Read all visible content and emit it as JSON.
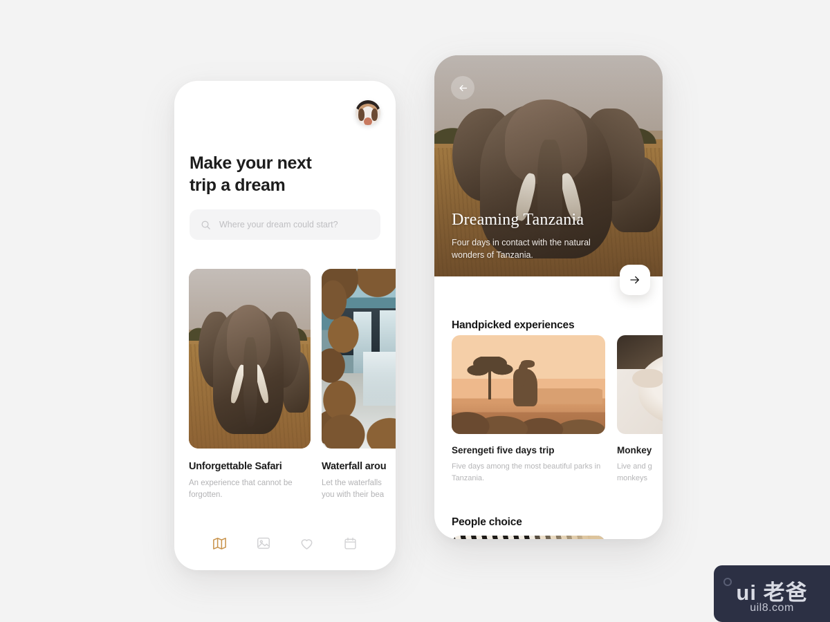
{
  "background_color": "#f3f3f3",
  "accent_color": "#c8924a",
  "left_phone": {
    "avatar": {
      "name": "user-avatar"
    },
    "headline": "Make your next\ntrip a dream",
    "search": {
      "placeholder": "Where your dream could start?",
      "value": "",
      "icon": "search-icon"
    },
    "cards": [
      {
        "image": "elephant-savanna",
        "title": "Unforgettable Safari",
        "description": "An experience that cannot be forgotten."
      },
      {
        "image": "waterfall-forest",
        "title": "Waterfall arou",
        "description": "Let the waterfalls\nyou with their bea"
      }
    ],
    "bottom_nav": [
      {
        "icon": "map-icon",
        "label": "Map",
        "active": true
      },
      {
        "icon": "image-icon",
        "label": "Gallery",
        "active": false
      },
      {
        "icon": "heart-icon",
        "label": "Favorites",
        "active": false
      },
      {
        "icon": "calendar-icon",
        "label": "Calendar",
        "active": false
      }
    ]
  },
  "right_phone": {
    "back_button": {
      "icon": "arrow-left-icon"
    },
    "hero": {
      "image": "elephants-savanna",
      "title": "Dreaming Tanzania",
      "subtitle": "Four days in contact with the natural wonders of Tanzania."
    },
    "next_button": {
      "icon": "arrow-right-icon"
    },
    "sections": [
      {
        "title": "Handpicked experiences"
      },
      {
        "title": "People choice"
      }
    ],
    "experiences": [
      {
        "image": "giraffe-sunset",
        "title": "Serengeti five days trip",
        "description": "Five days among the most beautiful parks in Tanzania."
      },
      {
        "image": "monkey-closeup",
        "title": "Monkey",
        "description": "Live and g\nmonkeys"
      }
    ],
    "people_choice": [
      {
        "image": "zebra-stripes"
      }
    ]
  },
  "watermark": {
    "main": "ui 老爸",
    "sub": "uil8.com"
  }
}
